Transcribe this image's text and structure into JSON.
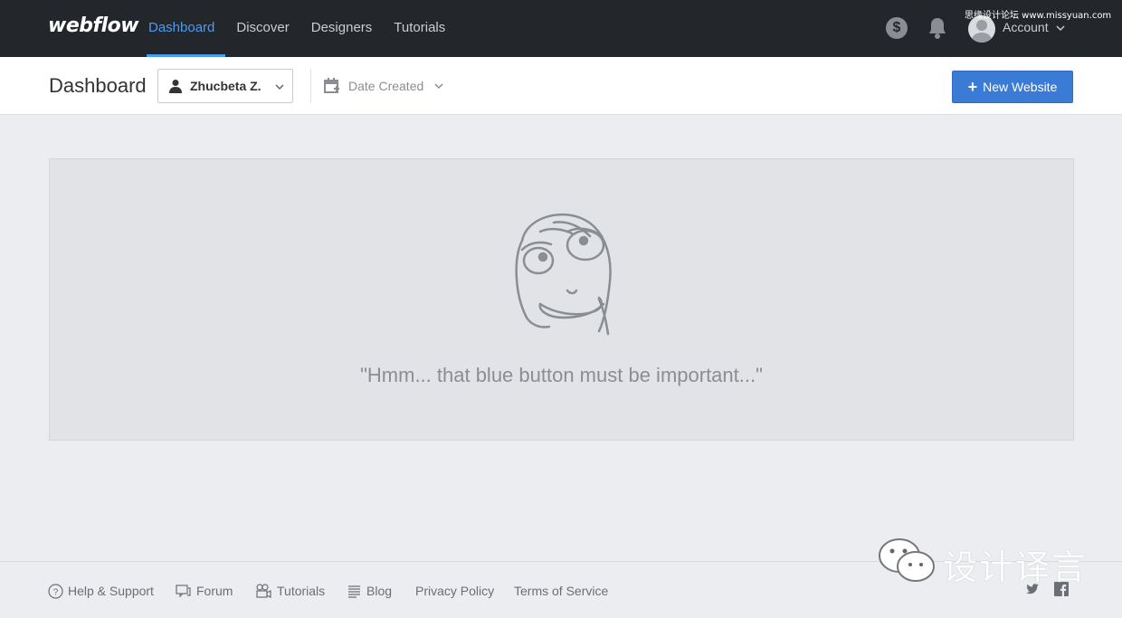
{
  "app": {
    "logo": "webflow"
  },
  "nav": {
    "items": [
      {
        "label": "Dashboard",
        "active": true
      },
      {
        "label": "Discover",
        "active": false
      },
      {
        "label": "Designers",
        "active": false
      },
      {
        "label": "Tutorials",
        "active": false
      }
    ]
  },
  "header": {
    "account_label": "Account",
    "icons": [
      "dollar-icon",
      "bell-icon",
      "avatar-icon",
      "chevron-down-icon"
    ]
  },
  "watermark": {
    "top": "思缘设计论坛 www.missyuan.com",
    "bottom": "设计译言"
  },
  "toolbar": {
    "title": "Dashboard",
    "user_filter": "Zhucbeta Z.",
    "sort_filter": "Date Created",
    "new_button": "New Website"
  },
  "empty_state": {
    "message": "\"Hmm... that blue button must be important...\""
  },
  "footer": {
    "links": [
      "Help & Support",
      "Forum",
      "Tutorials",
      "Blog",
      "Privacy Policy",
      "Terms of Service"
    ],
    "social": [
      "twitter-icon",
      "facebook-icon"
    ]
  },
  "colors": {
    "accent": "#4b9cf0",
    "button": "#3a7bd5",
    "topbar": "#23262b"
  }
}
